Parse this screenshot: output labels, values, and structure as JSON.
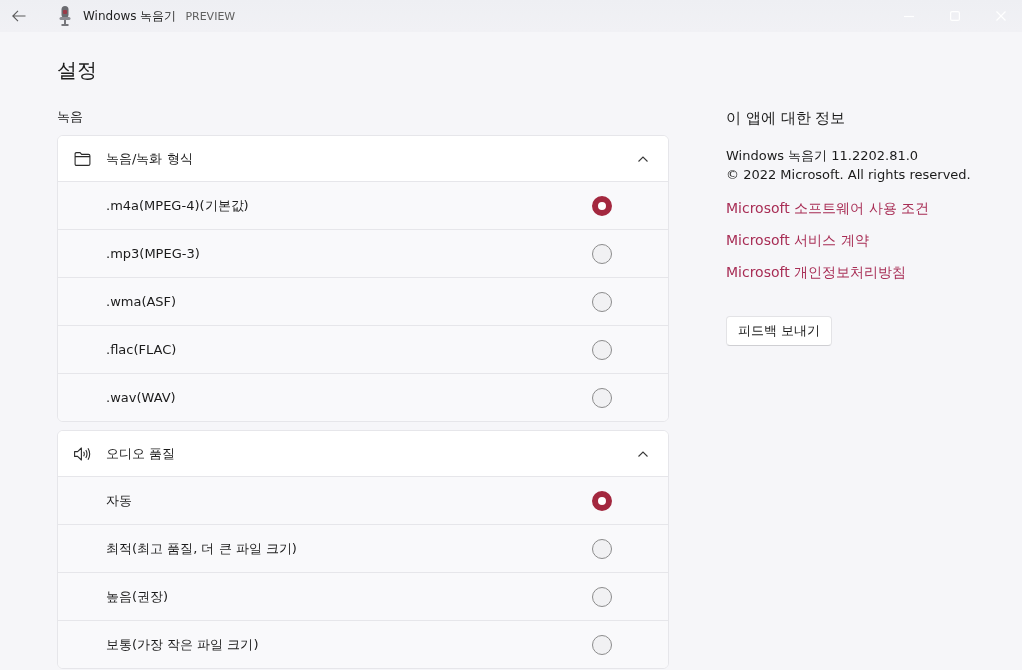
{
  "window": {
    "title": "Windows 녹음기",
    "badge": "PREVIEW"
  },
  "page": {
    "title": "설정",
    "section": "녹음"
  },
  "groups": [
    {
      "title": "녹음/녹화 형식",
      "expanded": true,
      "options": [
        {
          "label": ".m4a(MPEG-4)(기본값)",
          "selected": true
        },
        {
          "label": ".mp3(MPEG-3)",
          "selected": false
        },
        {
          "label": ".wma(ASF)",
          "selected": false
        },
        {
          "label": ".flac(FLAC)",
          "selected": false
        },
        {
          "label": ".wav(WAV)",
          "selected": false
        }
      ]
    },
    {
      "title": "오디오 품질",
      "expanded": true,
      "options": [
        {
          "label": "자동",
          "selected": true
        },
        {
          "label": "최적(최고 품질, 더 큰 파일 크기)",
          "selected": false
        },
        {
          "label": "높음(권장)",
          "selected": false
        },
        {
          "label": "보통(가장 작은 파일 크기)",
          "selected": false
        }
      ]
    }
  ],
  "about": {
    "heading": "이 앱에 대한 정보",
    "lines": [
      "Windows 녹음기 11.2202.81.0",
      "© 2022 Microsoft. All rights reserved."
    ],
    "links": [
      "Microsoft 소프트웨어 사용 조건",
      "Microsoft 서비스 계약",
      "Microsoft 개인정보처리방침"
    ],
    "button": "피드백 보내기"
  }
}
